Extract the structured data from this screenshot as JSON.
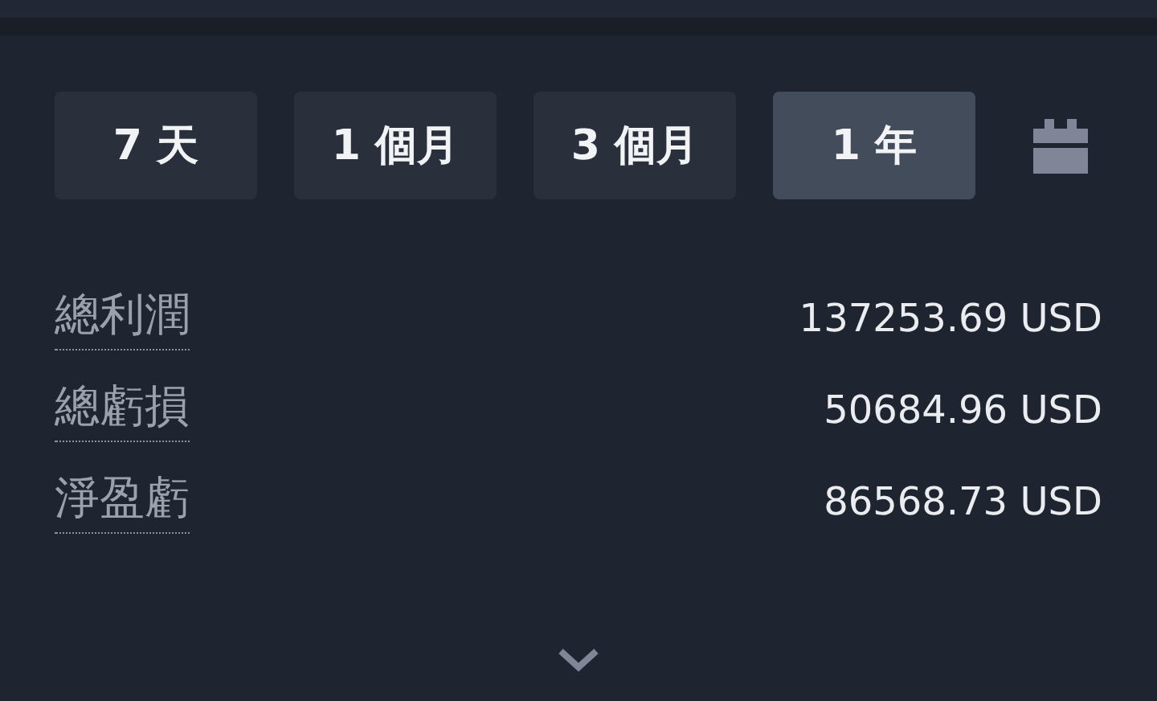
{
  "periods": [
    {
      "label": "7 天",
      "selected": false
    },
    {
      "label": "1 個月",
      "selected": false
    },
    {
      "label": "3 個月",
      "selected": false
    },
    {
      "label": "1 年",
      "selected": true
    }
  ],
  "stats": [
    {
      "label": "總利潤",
      "value": "137253.69 USD"
    },
    {
      "label": "總虧損",
      "value": "50684.96 USD"
    },
    {
      "label": "淨盈虧",
      "value": "86568.73 USD"
    }
  ]
}
